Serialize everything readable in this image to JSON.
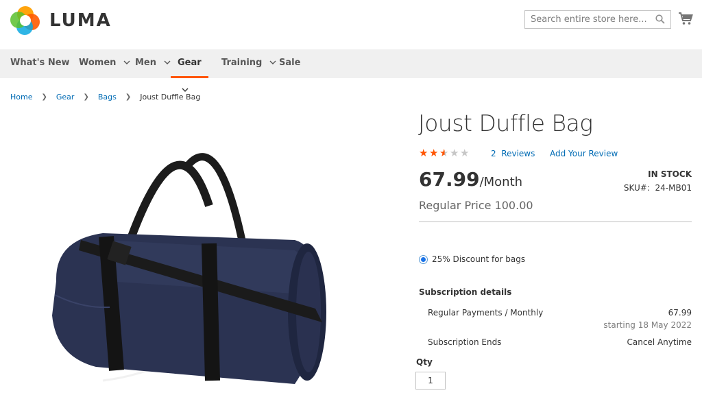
{
  "header": {
    "logo_text": "LUMA",
    "search_placeholder": "Search entire store here...",
    "icons": [
      "luma-logo-icon",
      "search-icon",
      "cart-icon"
    ]
  },
  "nav": {
    "items": [
      {
        "label": "What's New",
        "has_dropdown": false
      },
      {
        "label": "Women",
        "has_dropdown": true
      },
      {
        "label": "Men",
        "has_dropdown": true
      },
      {
        "label": "Gear",
        "has_dropdown": true,
        "active": true
      },
      {
        "label": "Training",
        "has_dropdown": true
      },
      {
        "label": "Sale",
        "has_dropdown": false
      }
    ]
  },
  "breadcrumbs": [
    {
      "label": "Home",
      "link": true
    },
    {
      "label": "Gear",
      "link": true
    },
    {
      "label": "Bags",
      "link": true
    },
    {
      "label": "Joust Duffle Bag",
      "link": false
    }
  ],
  "product": {
    "title": "Joust Duffle Bag",
    "rating": {
      "value": 2.5,
      "max": 5
    },
    "reviews_count": "2",
    "reviews_label": "Reviews",
    "add_review_label": "Add Your Review",
    "price": "67.99",
    "price_period": "/Month",
    "regular_price": "Regular Price 100.00",
    "stock": "IN STOCK",
    "sku_label": "SKU#:",
    "sku": "24-MB01",
    "discount_option": "25% Discount for bags",
    "subscription": {
      "title": "Subscription details",
      "rows": [
        {
          "label": "Regular Payments / Monthly",
          "value": "67.99",
          "note": "starting 18 May 2022"
        },
        {
          "label": "Subscription Ends",
          "value": "Cancel Anytime"
        }
      ]
    },
    "qty_label": "Qty",
    "qty_value": "1"
  },
  "colors": {
    "accent": "#ff5501",
    "link": "#006bb4",
    "star": "#ff5501",
    "nav_bg": "#f0f0f0"
  }
}
